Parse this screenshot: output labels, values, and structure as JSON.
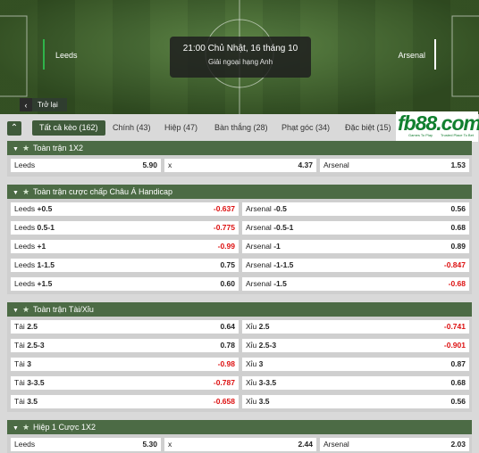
{
  "match": {
    "time": "21:00 Chủ Nhật, 16 tháng 10",
    "league": "Giải ngoại hạng Anh",
    "home": "Leeds",
    "away": "Arsenal",
    "back_label": "Trở lại"
  },
  "tabs": [
    {
      "label": "Tất cả kèo (162)",
      "active": true
    },
    {
      "label": "Chính (43)"
    },
    {
      "label": "Hiệp (47)"
    },
    {
      "label": "Bàn thắng (28)"
    },
    {
      "label": "Phạt góc (34)"
    },
    {
      "label": "Đặc biệt (15)"
    }
  ],
  "logo": {
    "text": "fb88.com",
    "tag1": "Games To Play",
    "tag2": "Trusted Place To Bet"
  },
  "sections": [
    {
      "title": "Toàn trận 1X2",
      "rows": [
        [
          {
            "name": "Leeds",
            "line": "",
            "odds": "5.90"
          },
          {
            "name": "x",
            "line": "",
            "odds": "4.37"
          },
          {
            "name": "Arsenal",
            "line": "",
            "odds": "1.53"
          }
        ]
      ]
    },
    {
      "title": "Toàn trận cược chấp Châu Á Handicap",
      "rows": [
        [
          {
            "name": "Leeds",
            "line": "+0.5",
            "odds": "-0.637"
          },
          {
            "name": "Arsenal",
            "line": "-0.5",
            "odds": "0.56"
          }
        ],
        [
          {
            "name": "Leeds",
            "line": "0.5-1",
            "odds": "-0.775"
          },
          {
            "name": "Arsenal",
            "line": "-0.5-1",
            "odds": "0.68"
          }
        ],
        [
          {
            "name": "Leeds",
            "line": "+1",
            "odds": "-0.99"
          },
          {
            "name": "Arsenal",
            "line": "-1",
            "odds": "0.89"
          }
        ],
        [
          {
            "name": "Leeds",
            "line": "1-1.5",
            "odds": "0.75"
          },
          {
            "name": "Arsenal",
            "line": "-1-1.5",
            "odds": "-0.847"
          }
        ],
        [
          {
            "name": "Leeds",
            "line": "+1.5",
            "odds": "0.60"
          },
          {
            "name": "Arsenal",
            "line": "-1.5",
            "odds": "-0.68"
          }
        ]
      ]
    },
    {
      "title": "Toàn trận Tài/Xỉu",
      "rows": [
        [
          {
            "name": "Tài",
            "line": "2.5",
            "odds": "0.64"
          },
          {
            "name": "Xỉu",
            "line": "2.5",
            "odds": "-0.741"
          }
        ],
        [
          {
            "name": "Tài",
            "line": "2.5-3",
            "odds": "0.78"
          },
          {
            "name": "Xỉu",
            "line": "2.5-3",
            "odds": "-0.901"
          }
        ],
        [
          {
            "name": "Tài",
            "line": "3",
            "odds": "-0.98"
          },
          {
            "name": "Xỉu",
            "line": "3",
            "odds": "0.87"
          }
        ],
        [
          {
            "name": "Tài",
            "line": "3-3.5",
            "odds": "-0.787"
          },
          {
            "name": "Xỉu",
            "line": "3-3.5",
            "odds": "0.68"
          }
        ],
        [
          {
            "name": "Tài",
            "line": "3.5",
            "odds": "-0.658"
          },
          {
            "name": "Xỉu",
            "line": "3.5",
            "odds": "0.56"
          }
        ]
      ]
    },
    {
      "title": "Hiệp 1 Cược 1X2",
      "rows": [
        [
          {
            "name": "Leeds",
            "line": "",
            "odds": "5.30"
          },
          {
            "name": "x",
            "line": "",
            "odds": "2.44"
          },
          {
            "name": "Arsenal",
            "line": "",
            "odds": "2.03"
          }
        ]
      ]
    }
  ],
  "colors": {
    "header": "#4c6b45",
    "negative": "#dd1111",
    "accent": "#2fb34a"
  }
}
